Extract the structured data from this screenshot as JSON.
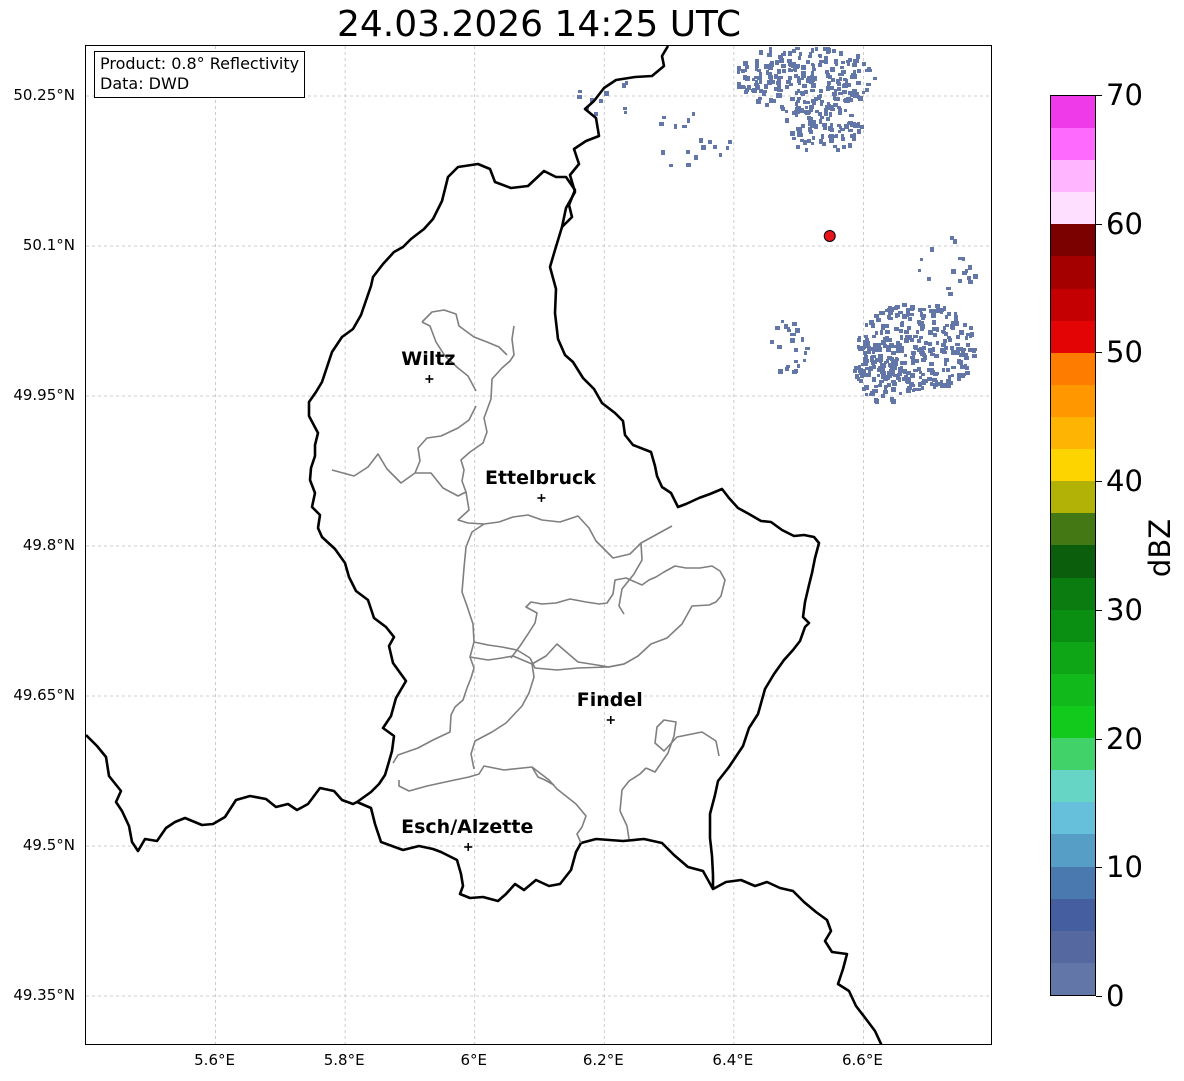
{
  "title": "24.03.2026 14:25 UTC",
  "info": {
    "product_line": "Product: 0.8° Reflectivity",
    "data_line": "Data: DWD"
  },
  "map": {
    "lon_range": [
      5.4,
      6.8
    ],
    "lat_range": [
      49.3,
      50.3
    ],
    "x_ticks": [
      {
        "value": 5.6,
        "label": "5.6°E"
      },
      {
        "value": 5.8,
        "label": "5.8°E"
      },
      {
        "value": 6.0,
        "label": "6°E"
      },
      {
        "value": 6.2,
        "label": "6.2°E"
      },
      {
        "value": 6.4,
        "label": "6.4°E"
      },
      {
        "value": 6.6,
        "label": "6.6°E"
      }
    ],
    "y_ticks": [
      {
        "value": 50.25,
        "label": "50.25°N"
      },
      {
        "value": 50.1,
        "label": "50.1°N"
      },
      {
        "value": 49.95,
        "label": "49.95°N"
      },
      {
        "value": 49.8,
        "label": "49.8°N"
      },
      {
        "value": 49.65,
        "label": "49.65°N"
      },
      {
        "value": 49.5,
        "label": "49.5°N"
      },
      {
        "value": 49.35,
        "label": "49.35°N"
      }
    ],
    "grid": true,
    "cities": [
      {
        "name": "Wiltz",
        "lon": 5.93,
        "lat": 49.967
      },
      {
        "name": "Ettelbruck",
        "lon": 6.103,
        "lat": 49.848
      },
      {
        "name": "Findel",
        "lon": 6.21,
        "lat": 49.626
      },
      {
        "name": "Esch/Alzette",
        "lon": 5.99,
        "lat": 49.499
      }
    ],
    "radar_site": {
      "lon": 6.548,
      "lat": 50.11,
      "color": "#e8141c"
    },
    "echo_color": "#6276a8"
  },
  "colorbar": {
    "label": "dBZ",
    "min": 0,
    "max": 70,
    "ticks": [
      "0",
      "10",
      "20",
      "30",
      "40",
      "50",
      "60",
      "70"
    ],
    "colors": [
      "#6376a8",
      "#55689f",
      "#445e9f",
      "#4a79b0",
      "#579ec7",
      "#66c0dc",
      "#66d5c5",
      "#41d26a",
      "#12ca1c",
      "#11b91b",
      "#0ea517",
      "#0b8f12",
      "#0b7c10",
      "#0a5e0c",
      "#437814",
      "#b2b206",
      "#fdd400",
      "#fdb402",
      "#fe9700",
      "#fe7d00",
      "#e30505",
      "#c40002",
      "#a50000",
      "#7b0000",
      "#ffdfff",
      "#ffb5ff",
      "#fe6afe",
      "#ee3ae9"
    ]
  }
}
